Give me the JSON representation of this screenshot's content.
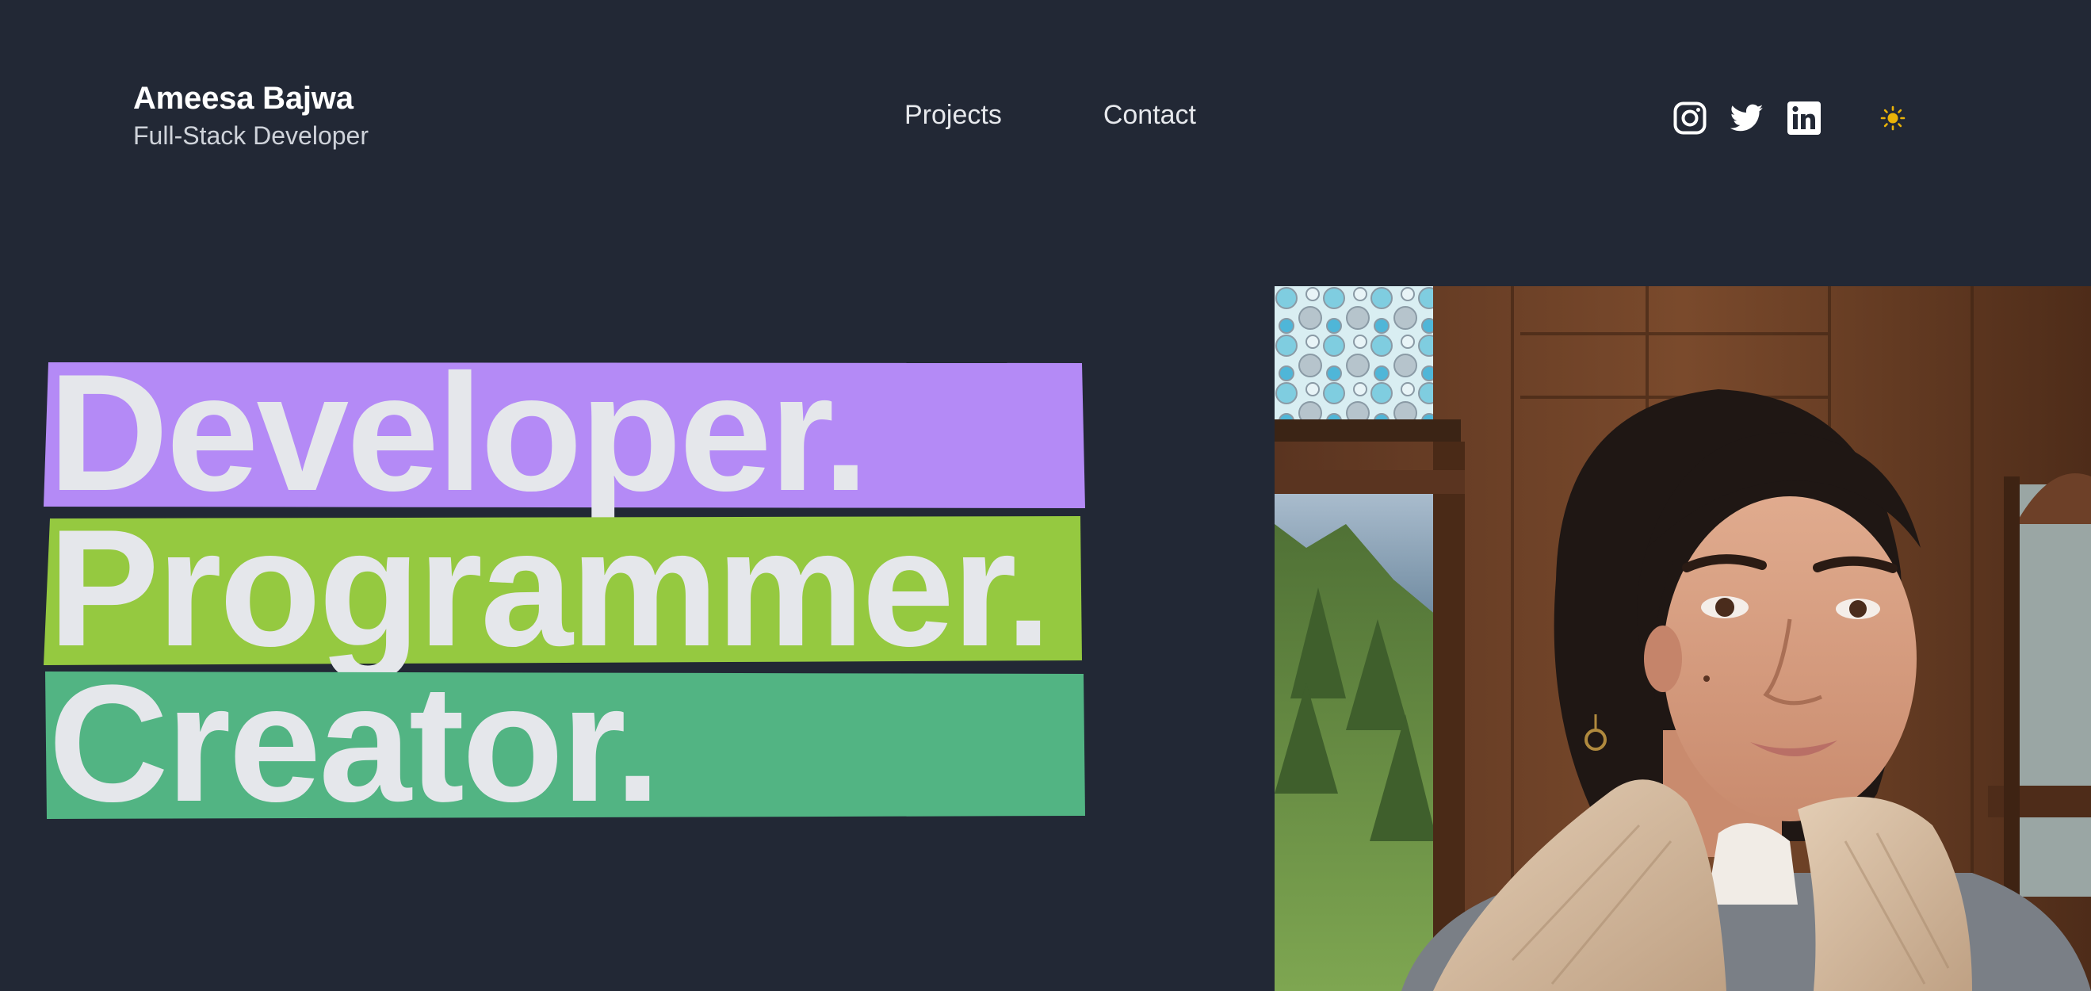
{
  "header": {
    "name": "Ameesa Bajwa",
    "role": "Full-Stack Developer"
  },
  "nav": {
    "projects": "Projects",
    "contact": "Contact"
  },
  "socials": {
    "instagram": "instagram-icon",
    "twitter": "twitter-icon",
    "linkedin": "linkedin-icon"
  },
  "theme_toggle": {
    "icon": "sun-icon",
    "color": "#eab308"
  },
  "hero": {
    "words": [
      {
        "text": "Developer.",
        "color": "#b48af6"
      },
      {
        "text": "Programmer.",
        "color": "#95c940"
      },
      {
        "text": "Creator.",
        "color": "#52b483"
      }
    ]
  },
  "colors": {
    "background": "#222835",
    "text": "#e5e7eb"
  }
}
